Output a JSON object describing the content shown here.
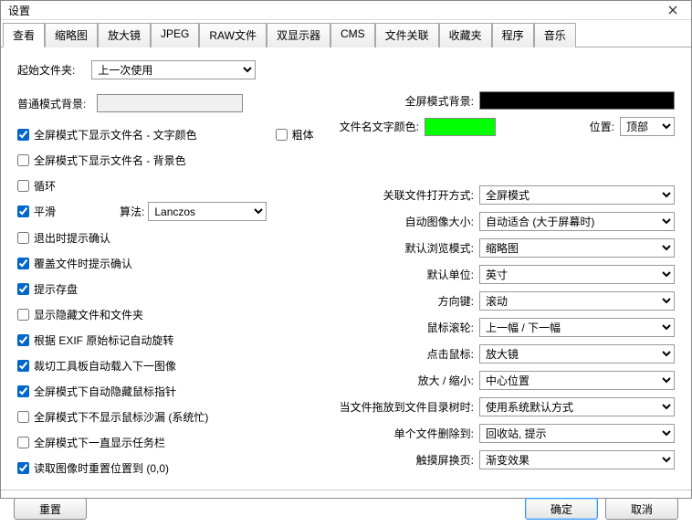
{
  "window": {
    "title": "设置"
  },
  "tabs": [
    "查看",
    "缩略图",
    "放大镜",
    "JPEG",
    "RAW文件",
    "双显示器",
    "CMS",
    "文件关联",
    "收藏夹",
    "程序",
    "音乐"
  ],
  "active_tab": 0,
  "left": {
    "start_folder_label": "起始文件夹:",
    "start_folder_value": "上一次使用",
    "normal_bg_label": "普通模式背景:",
    "checks": {
      "fullscreen_fn_textcolor": "全屏模式下显示文件名 - 文字颜色",
      "fullscreen_fn_bgcolor": "全屏模式下显示文件名 - 背景色",
      "loop": "循环",
      "smooth": "平滑",
      "confirm_exit": "退出时提示确认",
      "confirm_overwrite": "覆盖文件时提示确认",
      "disk_prompt": "提示存盘",
      "show_hidden": "显示隐藏文件和文件夹",
      "exif_rotate": "根据 EXIF 原始标记自动旋转",
      "crop_autoload_next": "裁切工具板自动载入下一图像",
      "hide_cursor_fullscreen": "全屏模式下自动隐藏鼠标指针",
      "no_busy_cursor": "全屏模式下不显示鼠标沙漏 (系统忙)",
      "always_taskbar": "全屏模式下一直显示任务栏",
      "reset_to_00": "读取图像时重置位置到 (0,0)"
    },
    "algo_label": "算法:",
    "algo_value": "Lanczos",
    "bold_label": "粗体"
  },
  "right": {
    "fullscreen_bg_label": "全屏模式背景:",
    "filename_textcolor_label": "文件名文字颜色:",
    "position_label": "位置:",
    "position_value": "顶部",
    "rows": [
      {
        "label": "关联文件打开方式:",
        "value": "全屏模式"
      },
      {
        "label": "自动图像大小:",
        "value": "自动适合 (大于屏幕时)"
      },
      {
        "label": "默认浏览模式:",
        "value": "缩略图"
      },
      {
        "label": "默认单位:",
        "value": "英寸"
      },
      {
        "label": "方向键:",
        "value": "滚动"
      },
      {
        "label": "鼠标滚轮:",
        "value": "上一幅 / 下一幅"
      },
      {
        "label": "点击鼠标:",
        "value": "放大镜"
      },
      {
        "label": "放大 / 缩小:",
        "value": "中心位置"
      },
      {
        "label": "当文件拖放到文件目录树时:",
        "value": "使用系统默认方式"
      },
      {
        "label": "单个文件删除到:",
        "value": "回收站, 提示"
      },
      {
        "label": "触摸屏换页:",
        "value": "渐变效果"
      }
    ]
  },
  "buttons": {
    "reset": "重置",
    "ok": "确定",
    "cancel": "取消"
  }
}
